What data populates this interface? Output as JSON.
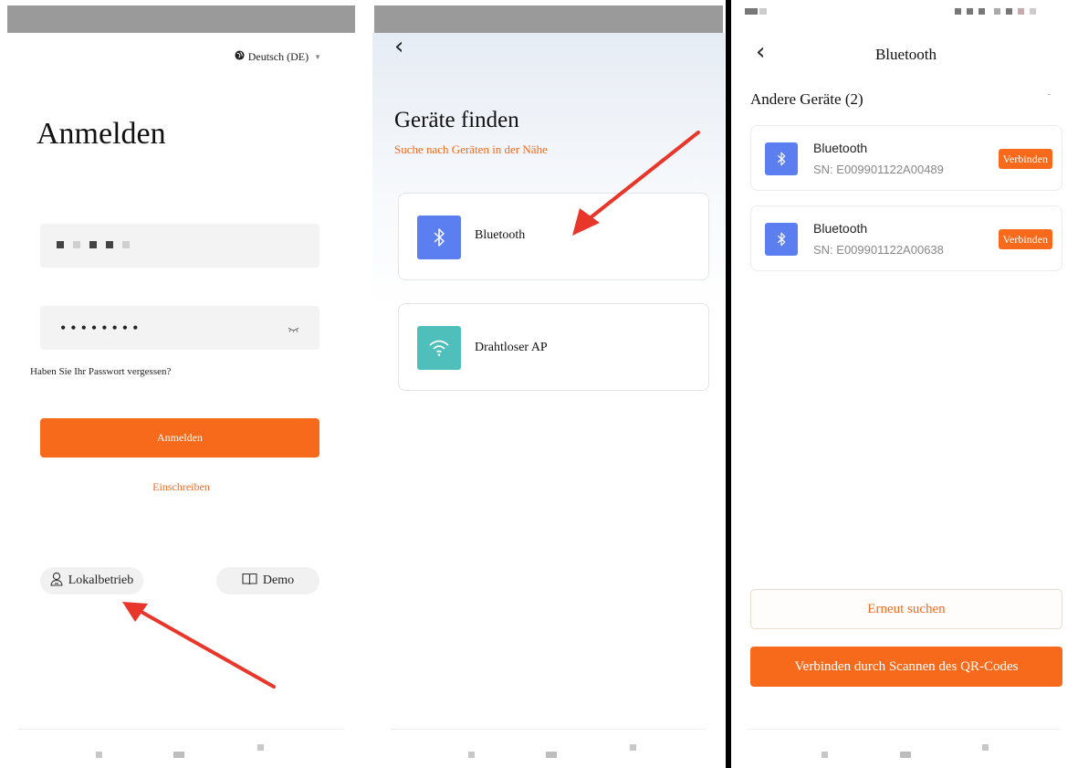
{
  "login_screen": {
    "language": "Deutsch (DE)",
    "title": "Anmelden",
    "password_mask": "••••••••",
    "forgot_password": "Haben Sie Ihr Passwort vergessen?",
    "login_button": "Anmelden",
    "register_link": "Einschreiben",
    "local_mode_button": "Lokalbetrieb",
    "demo_button": "Demo"
  },
  "find_devices_screen": {
    "title": "Geräte finden",
    "subtitle": "Suche nach Geräten in der Nähe",
    "options": [
      {
        "label": "Bluetooth",
        "icon": "bluetooth-icon",
        "color": "#5b7ef0"
      },
      {
        "label": "Drahtloser AP",
        "icon": "wifi-icon",
        "color": "#4fbfbc"
      }
    ]
  },
  "bluetooth_screen": {
    "title": "Bluetooth",
    "section_title": "Andere Geräte (2)",
    "section_hint": "-",
    "devices": [
      {
        "name": "Bluetooth",
        "sn": "SN: E009901122A00489",
        "action": "Verbinden"
      },
      {
        "name": "Bluetooth",
        "sn": "SN: E009901122A00638",
        "action": "Verbinden"
      }
    ],
    "rescan_button": "Erneut suchen",
    "qr_button": "Verbinden durch Scannen des QR-Codes"
  },
  "theme": {
    "accent": "#f76a1b",
    "arrow": "#e8372a"
  }
}
